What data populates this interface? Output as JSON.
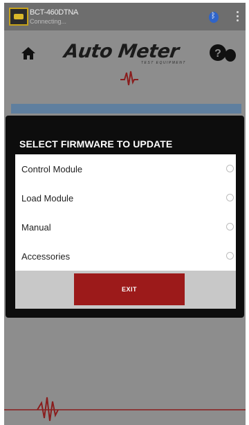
{
  "statusbar": {
    "device_name": "BCT-460DTNA",
    "connection_status": "Connecting..."
  },
  "header": {
    "logo_text": "Auto Meter",
    "logo_subtext": "TEST EQUIPMENT",
    "help_icon": "help-icon",
    "home_icon": "home-icon"
  },
  "modal": {
    "title": "SELECT FIRMWARE TO UPDATE",
    "options": [
      {
        "label": "Control Module"
      },
      {
        "label": "Load Module"
      },
      {
        "label": "Manual"
      },
      {
        "label": "Accessories"
      }
    ],
    "exit_label": "EXIT"
  },
  "colors": {
    "accent_red": "#9c1a1a",
    "overlay": "#8d8d8d",
    "modal_bg": "#0d0d0d"
  }
}
